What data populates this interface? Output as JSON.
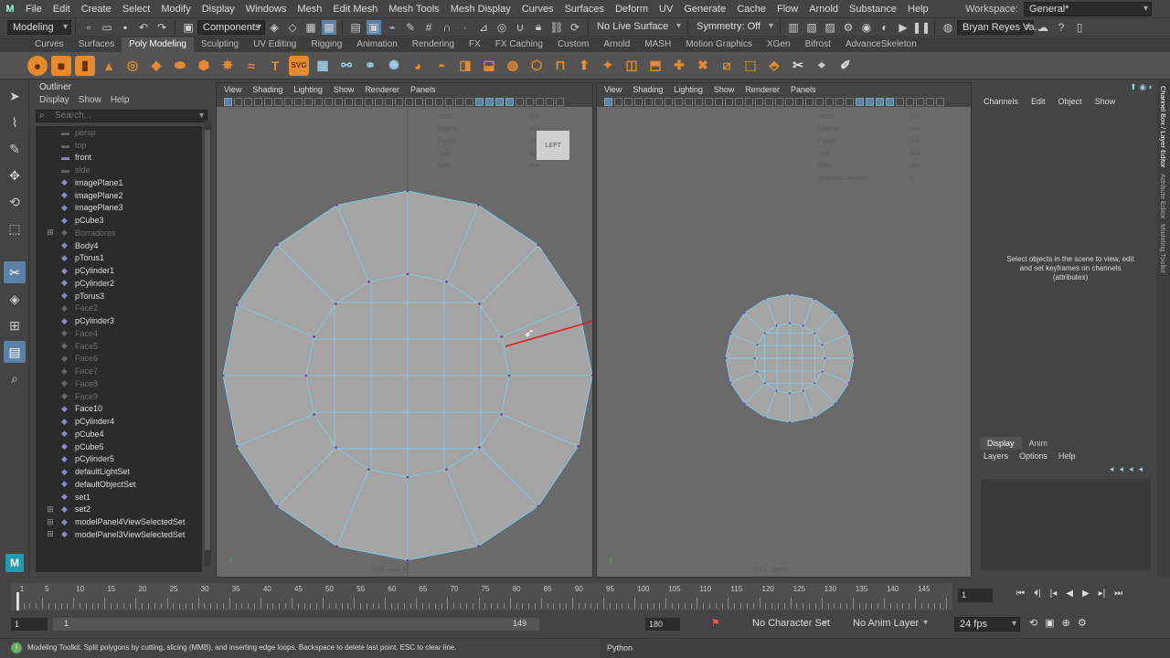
{
  "menubar": {
    "items": [
      "File",
      "Edit",
      "Create",
      "Select",
      "Modify",
      "Display",
      "Windows",
      "Mesh",
      "Edit Mesh",
      "Mesh Tools",
      "Mesh Display",
      "Curves",
      "Surfaces",
      "Deform",
      "UV",
      "Generate",
      "Cache",
      "Flow",
      "Arnold",
      "Substance",
      "Help"
    ],
    "workspace_label": "Workspace:",
    "workspace_value": "General*"
  },
  "statusline": {
    "mode": "Modeling",
    "components": "Components",
    "live_surface": "No Live Surface",
    "symmetry": "Symmetry: Off",
    "user": "Bryan Reyes Va..."
  },
  "shelf": {
    "tabs": [
      "Curves",
      "Surfaces",
      "Poly Modeling",
      "Sculpting",
      "UV Editing",
      "Rigging",
      "Animation",
      "Rendering",
      "FX",
      "FX Caching",
      "Custom",
      "Arnold",
      "MASH",
      "Motion Graphics",
      "XGen",
      "Bifrost",
      "AdvanceSkeleton"
    ],
    "active_tab": "Poly Modeling",
    "svg_label": "SVG",
    "text_tool_glyph": "T"
  },
  "outliner": {
    "title": "Outliner",
    "menu": [
      "Display",
      "Show",
      "Help"
    ],
    "search_placeholder": "Search...",
    "items": [
      {
        "name": "persp",
        "dim": true,
        "icon": "camera"
      },
      {
        "name": "top",
        "dim": true,
        "icon": "camera"
      },
      {
        "name": "front",
        "dim": false,
        "icon": "camera"
      },
      {
        "name": "side",
        "dim": true,
        "icon": "camera"
      },
      {
        "name": "imagePlane1",
        "dim": false,
        "icon": "image-plane"
      },
      {
        "name": "imagePlane2",
        "dim": false,
        "icon": "image-plane"
      },
      {
        "name": "imagePlane3",
        "dim": false,
        "icon": "image-plane"
      },
      {
        "name": "pCube3",
        "dim": false,
        "icon": "mesh"
      },
      {
        "name": "Borradores",
        "dim": true,
        "icon": "group",
        "expand": true
      },
      {
        "name": "Body4",
        "dim": false,
        "icon": "mesh"
      },
      {
        "name": "pTorus1",
        "dim": false,
        "icon": "mesh"
      },
      {
        "name": "pCylinder1",
        "dim": false,
        "icon": "mesh"
      },
      {
        "name": "pCylinder2",
        "dim": false,
        "icon": "mesh"
      },
      {
        "name": "pTorus3",
        "dim": false,
        "icon": "mesh"
      },
      {
        "name": "Face2",
        "dim": true,
        "icon": "mesh"
      },
      {
        "name": "pCylinder3",
        "dim": false,
        "icon": "mesh"
      },
      {
        "name": "Face4",
        "dim": true,
        "icon": "mesh"
      },
      {
        "name": "Face5",
        "dim": true,
        "icon": "mesh"
      },
      {
        "name": "Face6",
        "dim": true,
        "icon": "mesh"
      },
      {
        "name": "Face7",
        "dim": true,
        "icon": "mesh"
      },
      {
        "name": "Face8",
        "dim": true,
        "icon": "mesh"
      },
      {
        "name": "Face9",
        "dim": true,
        "icon": "mesh"
      },
      {
        "name": "Face10",
        "dim": false,
        "icon": "mesh"
      },
      {
        "name": "pCylinder4",
        "dim": false,
        "icon": "mesh"
      },
      {
        "name": "pCube4",
        "dim": false,
        "icon": "mesh"
      },
      {
        "name": "pCube5",
        "dim": false,
        "icon": "mesh"
      },
      {
        "name": "pCylinder5",
        "dim": false,
        "icon": "mesh"
      },
      {
        "name": "defaultLightSet",
        "dim": false,
        "icon": "set"
      },
      {
        "name": "defaultObjectSet",
        "dim": false,
        "icon": "set"
      },
      {
        "name": "set1",
        "dim": false,
        "icon": "set"
      },
      {
        "name": "set2",
        "dim": false,
        "icon": "set",
        "expand": true
      },
      {
        "name": "modelPanel4ViewSelectedSet",
        "dim": false,
        "icon": "set",
        "expand": true
      },
      {
        "name": "modelPanel3ViewSelectedSet",
        "dim": false,
        "icon": "set",
        "expand": true
      }
    ]
  },
  "viewport_left": {
    "menu": [
      "View",
      "Shading",
      "Lighting",
      "Show",
      "Renderer",
      "Panels"
    ],
    "cube_label": "LEFT",
    "hud_rows": [
      {
        "label": "Verts:",
        "value": "N/A"
      },
      {
        "label": "Edges:",
        "value": "N/A"
      },
      {
        "label": "Faces:",
        "value": "N/A"
      },
      {
        "label": "Tris:",
        "value": "N/A"
      },
      {
        "label": "UVs:",
        "value": "N/A"
      }
    ],
    "cam_label": "front -Axis X"
  },
  "viewport_right": {
    "menu": [
      "View",
      "Shading",
      "Lighting",
      "Show",
      "Renderer",
      "Panels"
    ],
    "hud_rows": [
      {
        "label": "Verts:",
        "value": "N/A"
      },
      {
        "label": "Edges:",
        "value": "N/A"
      },
      {
        "label": "Faces:",
        "value": "N/A"
      },
      {
        "label": "Tris:",
        "value": "N/A"
      },
      {
        "label": "UVs:",
        "value": "N/A"
      },
      {
        "label": "Selected Objects",
        "value": "0"
      }
    ],
    "cam_label": "front - persp"
  },
  "channelbox": {
    "menu": [
      "Channels",
      "Edit",
      "Object",
      "Show"
    ],
    "message": "Select objects in the scene to view, edit and set keyframes on channels (attributes)"
  },
  "sidetabs": [
    "Channel Box / Layer Editor",
    "Attribute Editor",
    "Modeling Toolkit"
  ],
  "layereditor": {
    "tabs": [
      "Display",
      "Anim"
    ],
    "menu": [
      "Layers",
      "Options",
      "Help"
    ]
  },
  "timeslider": {
    "ticks": [
      1,
      5,
      10,
      15,
      20,
      25,
      30,
      35,
      40,
      45,
      50,
      55,
      60,
      65,
      70,
      75,
      80,
      85,
      90,
      95,
      100,
      105,
      110,
      115,
      120,
      125,
      130,
      135,
      140,
      145
    ],
    "current_frame": "1"
  },
  "range": {
    "start": "1",
    "inner_start": "1",
    "inner_end": "149",
    "end": "180",
    "character_set": "No Character Set",
    "anim_layer": "No Anim Layer",
    "fps": "24 fps"
  },
  "helpline": {
    "text": "Modeling Toolkit: Split polygons by cutting, slicing (MMB), and inserting edge loops. Backspace to delete last point. ESC to clear line.",
    "python_label": "Python"
  },
  "colors": {
    "accent": "#5d82a8",
    "mesh_fill": "#a5a5a5",
    "wire": "#7fd4f0",
    "cut_line": "#e0201d"
  }
}
